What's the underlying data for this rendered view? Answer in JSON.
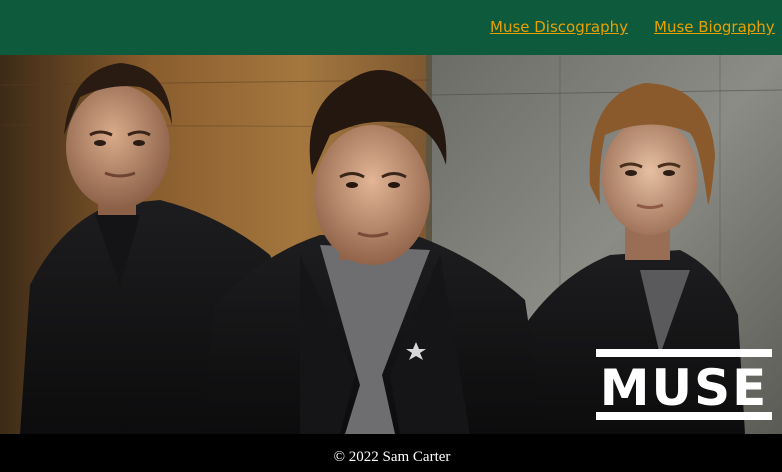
{
  "nav": {
    "links": [
      {
        "label": "Muse Discography"
      },
      {
        "label": "Muse Biography"
      }
    ]
  },
  "hero": {
    "logo_text": "MUSE"
  },
  "footer": {
    "copyright": "© 2022 Sam Carter"
  },
  "colors": {
    "header_bg": "#0e5a3c",
    "link": "#e8a000",
    "footer_bg": "#000000"
  }
}
